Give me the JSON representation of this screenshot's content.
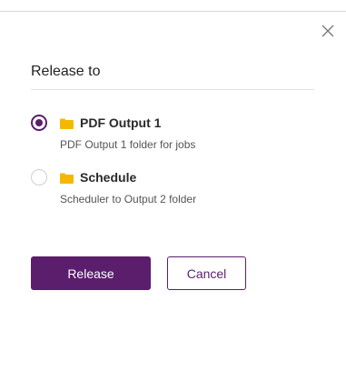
{
  "dialog": {
    "title": "Release to",
    "close_icon": "close-icon"
  },
  "options": [
    {
      "label": "PDF Output 1",
      "description": "PDF Output 1 folder for jobs",
      "selected": true,
      "icon": "folder-icon"
    },
    {
      "label": "Schedule",
      "description": "Scheduler to Output 2 folder",
      "selected": false,
      "icon": "folder-icon"
    }
  ],
  "buttons": {
    "release_label": "Release",
    "cancel_label": "Cancel"
  },
  "colors": {
    "accent": "#5b1e6d",
    "folder": "#f5b800"
  }
}
